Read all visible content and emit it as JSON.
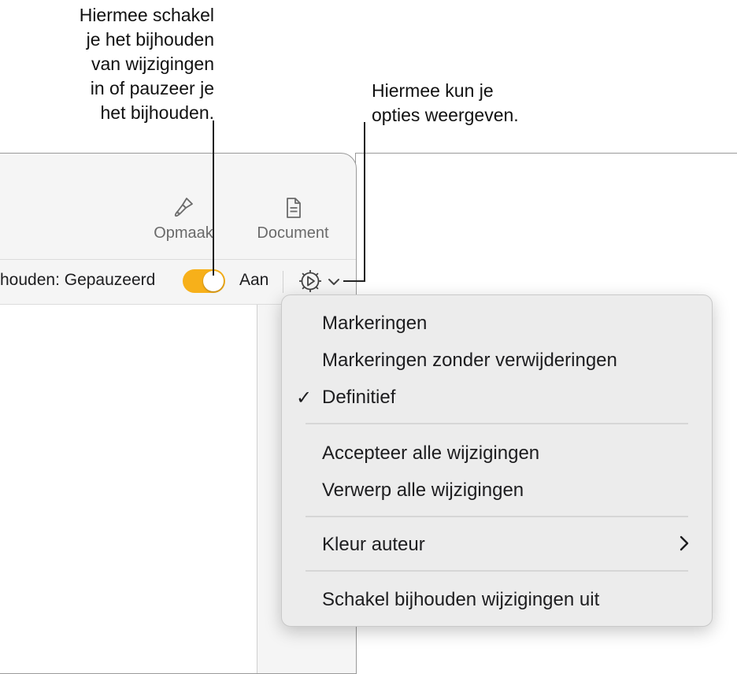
{
  "callouts": {
    "left_lines": [
      "Hiermee schakel",
      "je het bijhouden",
      "van wijzigingen",
      "in of pauzeer je",
      "het bijhouden."
    ],
    "right_lines": [
      "Hiermee kun je",
      "opties weergeven."
    ]
  },
  "toolbar": {
    "format_label": "Opmaak",
    "document_label": "Document"
  },
  "tracking": {
    "status_label": "houden: Gepauzeerd",
    "switch_state": "on",
    "on_label": "Aan",
    "accent_color": "#f7b01a"
  },
  "menu": {
    "items": [
      {
        "label": "Markeringen",
        "checked": false
      },
      {
        "label": "Markeringen zonder verwijderingen",
        "checked": false
      },
      {
        "label": "Definitief",
        "checked": true
      },
      {
        "label": "Accepteer alle wijzigingen"
      },
      {
        "label": "Verwerp alle wijzigingen"
      },
      {
        "label": "Kleur auteur",
        "submenu": true
      },
      {
        "label": "Schakel bijhouden wijzigingen uit"
      }
    ],
    "check_glyph": "✓"
  },
  "icons": {
    "format": "paintbrush-icon",
    "document": "document-icon",
    "options": "gear-icon",
    "dropdown": "chevron-down-icon",
    "submenu": "chevron-right-icon"
  }
}
